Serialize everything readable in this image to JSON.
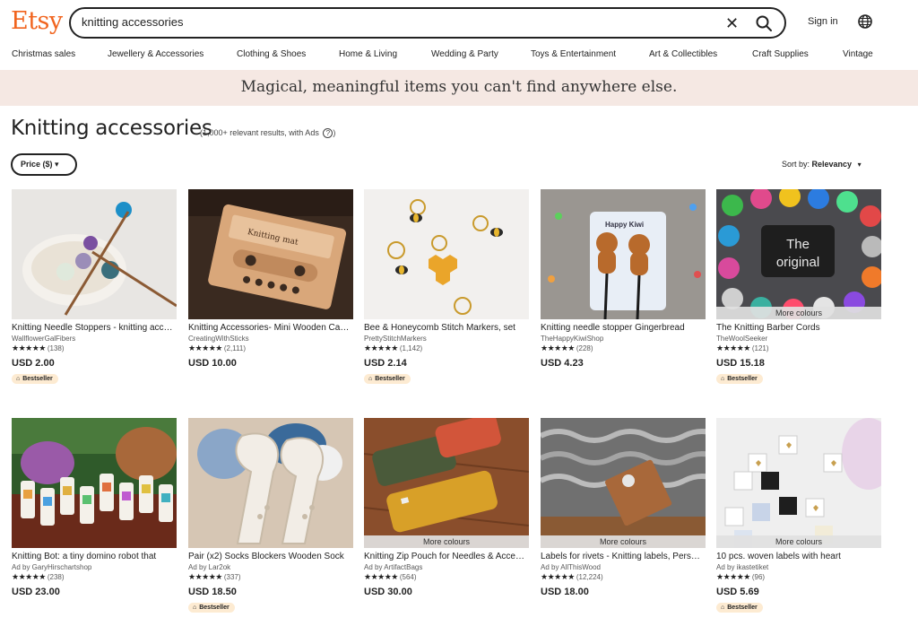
{
  "header": {
    "logo": "Etsy",
    "search_value": "knitting accessories",
    "signin_label": "Sign in"
  },
  "categories": [
    "Christmas sales",
    "Jewellery & Accessories",
    "Clothing & Shoes",
    "Home & Living",
    "Wedding & Party",
    "Toys & Entertainment",
    "Art & Collectibles",
    "Craft Supplies",
    "Vintage"
  ],
  "banner": "Magical, meaningful items you can't find anywhere else.",
  "results": {
    "title": "Knitting accessories",
    "count_text": "(1,000+ relevant results, with Ads",
    "count_close": ")",
    "price_filter": "Price ($) ▾",
    "sort_prefix": "Sort by:",
    "sort_value": "Relevancy",
    "sort_caret": "▾"
  },
  "stars": "★★★★★",
  "products": [
    {
      "title": "Knitting Needle Stoppers - knitting accessories",
      "shop": "WallflowerGalFibers",
      "reviews": "(138)",
      "price": "USD 2.00",
      "badge": "Bestseller",
      "more": ""
    },
    {
      "title": "Knitting Accessories- Mini Wooden Cassette",
      "shop": "CreatingWithSticks",
      "reviews": "(2,111)",
      "price": "USD 10.00",
      "badge": "",
      "more": ""
    },
    {
      "title": "Bee & Honeycomb Stitch Markers, set",
      "shop": "PrettyStitchMarkers",
      "reviews": "(1,142)",
      "price": "USD 2.14",
      "badge": "Bestseller",
      "more": ""
    },
    {
      "title": "Knitting needle stopper Gingerbread",
      "shop": "TheHappyKiwiShop",
      "reviews": "(228)",
      "price": "USD 4.23",
      "badge": "",
      "more": ""
    },
    {
      "title": "The Knitting Barber Cords",
      "shop": "TheWoolSeeker",
      "reviews": "(121)",
      "price": "USD 15.18",
      "badge": "Bestseller",
      "more": "More colours"
    },
    {
      "title": "Knitting Bot: a tiny domino robot that",
      "shop": "Ad by GaryHirschartshop",
      "reviews": "(238)",
      "price": "USD 23.00",
      "badge": "",
      "more": ""
    },
    {
      "title": "Pair (x2) Socks Blockers Wooden Sock",
      "shop": "Ad by Lar2ok",
      "reviews": "(337)",
      "price": "USD 18.50",
      "badge": "Bestseller",
      "more": ""
    },
    {
      "title": "Knitting Zip Pouch for Needles & Accessories",
      "shop": "Ad by ArtifactBags",
      "reviews": "(564)",
      "price": "USD 30.00",
      "badge": "",
      "more": "More colours"
    },
    {
      "title": "Labels for rivets - Knitting labels, Personalized",
      "shop": "Ad by AllThisWood",
      "reviews": "(12,224)",
      "price": "USD 18.00",
      "badge": "",
      "more": "More colours"
    },
    {
      "title": "10 pcs. woven labels with heart",
      "shop": "Ad by ikastetiket",
      "reviews": "(96)",
      "price": "USD 5.69",
      "badge": "Bestseller",
      "more": "More colours"
    }
  ],
  "image_caption": [
    "The",
    "original"
  ],
  "image_overlays": [
    "Knitting mat",
    "Happy Kiwi"
  ],
  "colors": {
    "brand": "#f1641e",
    "banner_bg": "#f5e8e3",
    "badge_bg": "#fdebd2"
  }
}
